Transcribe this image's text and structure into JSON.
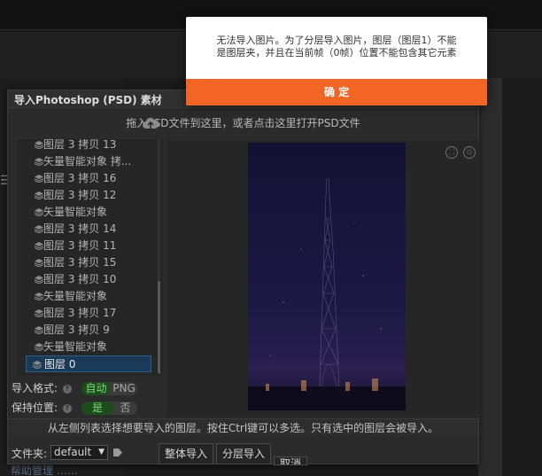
{
  "colors": {
    "accent": "#f26522",
    "selected_row": "#1a3a57",
    "toggle_on": "#7cd67c"
  },
  "background": {
    "bottom_text": "帮助管理 ……"
  },
  "dialog": {
    "title": "导入Photoshop (PSD) 素材",
    "drop_hint": "拖入PSD文件到这里，或者点击这里打开PSD文件",
    "layers": [
      {
        "label": "图层 3 拷贝 13",
        "icon": "layer-stack-icon"
      },
      {
        "label": "矢量智能对象 拷...",
        "icon": "layer-stack-icon"
      },
      {
        "label": "图层 3 拷贝 16",
        "icon": "layer-stack-icon"
      },
      {
        "label": "图层 3 拷贝 12",
        "icon": "layer-stack-icon"
      },
      {
        "label": "矢量智能对象",
        "icon": "layer-stack-icon"
      },
      {
        "label": "图层 3 拷贝 14",
        "icon": "layer-stack-icon"
      },
      {
        "label": "图层 3 拷贝 11",
        "icon": "layer-stack-icon"
      },
      {
        "label": "图层 3 拷贝 15",
        "icon": "layer-stack-icon"
      },
      {
        "label": "图层 3 拷贝 10",
        "icon": "layer-stack-icon"
      },
      {
        "label": "矢量智能对象",
        "icon": "layer-stack-icon"
      },
      {
        "label": "图层 3 拷贝 17",
        "icon": "layer-stack-icon"
      },
      {
        "label": "图层 3 拷贝 9",
        "icon": "layer-stack-icon"
      },
      {
        "label": "矢量智能对象",
        "icon": "layer-stack-icon"
      },
      {
        "label": "图层 0",
        "icon": "layer-stack-icon",
        "selected": true
      }
    ],
    "options": {
      "import_format_label": "导入格式:",
      "format_on": "自动",
      "format_off": "PNG",
      "keep_position_label": "保持位置:",
      "keep_on": "是",
      "keep_off": "否"
    },
    "footer_hint": "从左侧列表选择想要导入的图层。按住Ctrl键可以多选。只有选中的图层会被导入。",
    "folder_label": "文件夹:",
    "folder_value": "default",
    "buttons": {
      "import_whole": "整体导入",
      "import_layers": "分层导入",
      "cancel": "取消"
    }
  },
  "alert": {
    "message_line1": "无法导入图片。为了分层导入图片，图层（图层1）不能",
    "message_line2": "是图层夹，并且在当前帧（0帧）位置不能包含其它元素",
    "confirm_label": "确 定"
  }
}
